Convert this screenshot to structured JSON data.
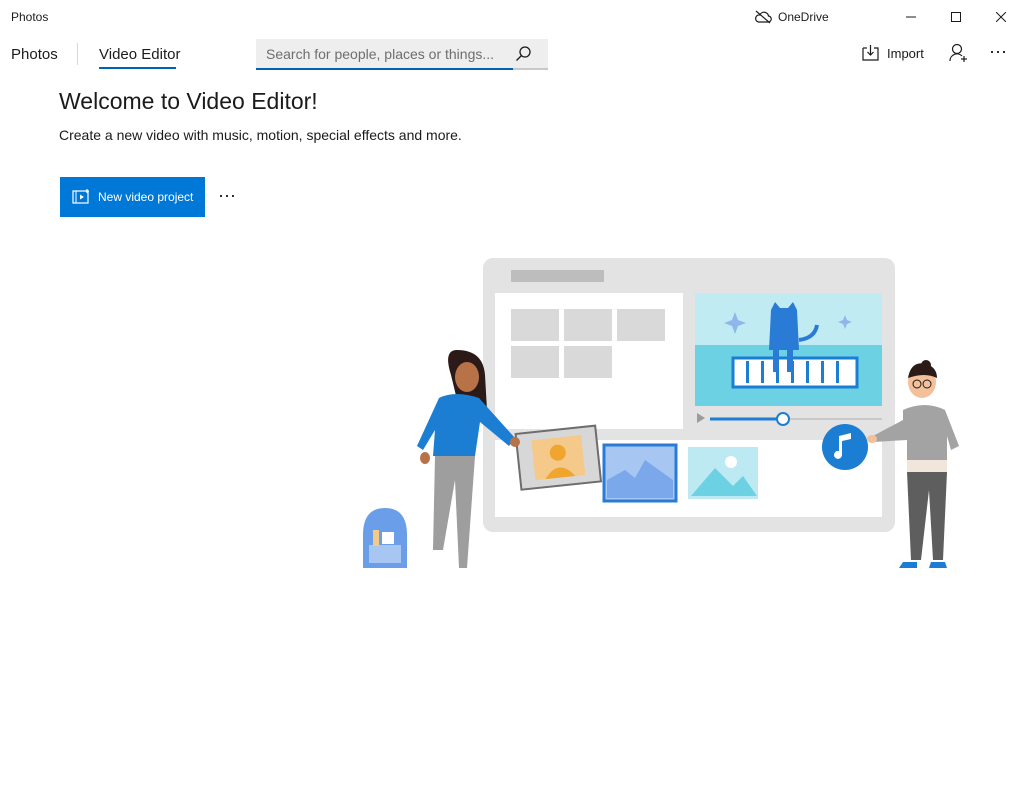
{
  "window": {
    "title": "Photos",
    "onedrive_label": "OneDrive"
  },
  "nav": {
    "tabs": [
      {
        "label": "Photos",
        "active": false
      },
      {
        "label": "Video Editor",
        "active": true
      }
    ],
    "search_placeholder": "Search for people, places or things...",
    "import_label": "Import"
  },
  "main": {
    "heading": "Welcome to Video Editor!",
    "subtitle": "Create a new video with music, motion, special effects and more.",
    "new_project_label": "New video project"
  },
  "colors": {
    "accent": "#0078d7",
    "accent_dark": "#0063b1"
  },
  "icons": [
    "onedrive-offline-icon",
    "minimize-icon",
    "maximize-icon",
    "close-icon",
    "search-icon",
    "import-icon",
    "person-add-icon",
    "more-icon",
    "video-project-icon"
  ]
}
